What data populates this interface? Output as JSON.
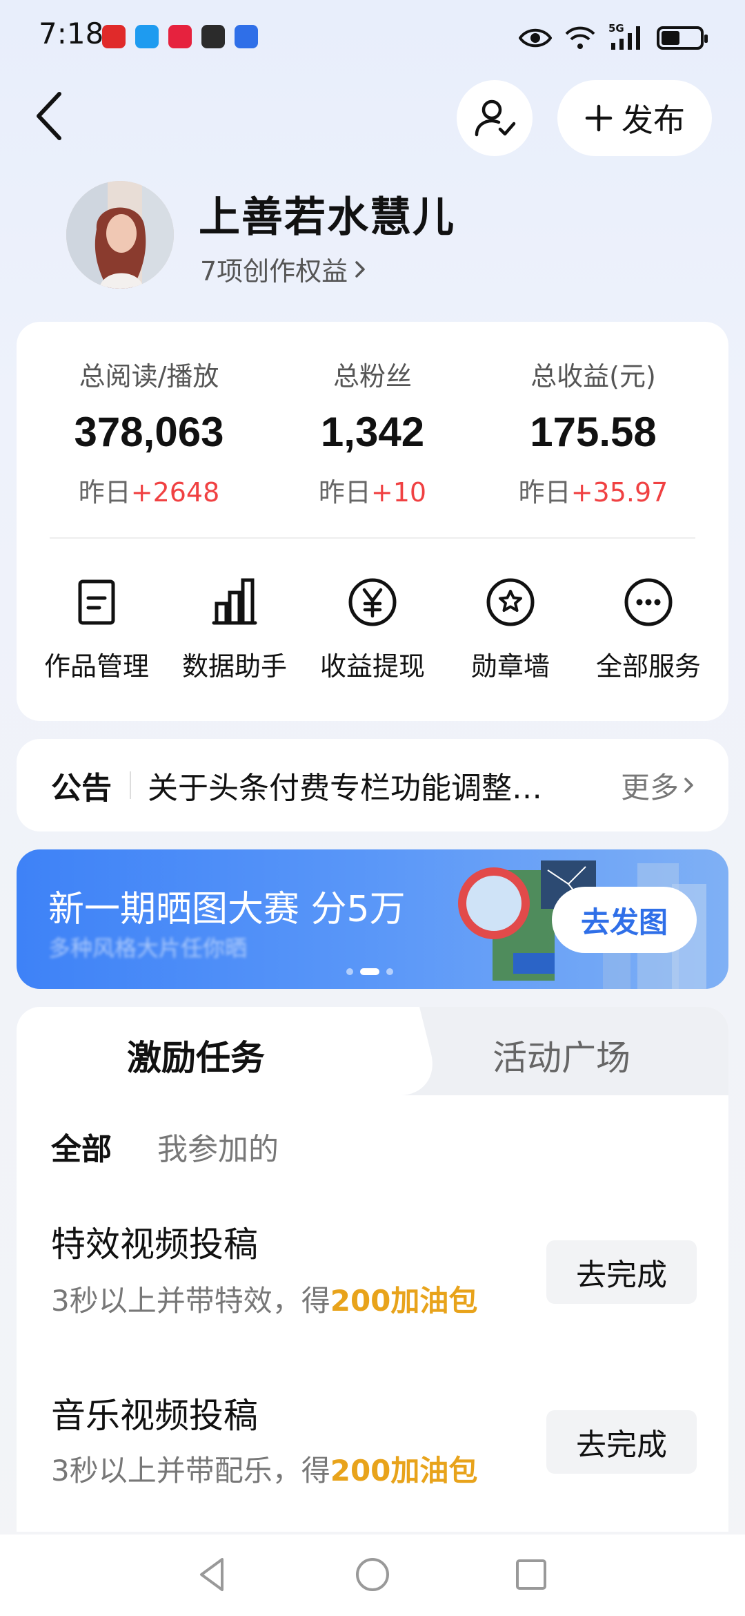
{
  "status_bar": {
    "time": "7:18",
    "network": "5G"
  },
  "header": {
    "back_icon": "chevron-left-icon",
    "follow_icon": "user-check-icon",
    "publish_label": "发布"
  },
  "profile": {
    "name": "上善若水慧儿",
    "benefits": "7项创作权益"
  },
  "stats": [
    {
      "label": "总阅读/播放",
      "value": "378,063",
      "delta_prefix": "昨日",
      "delta": "+2648"
    },
    {
      "label": "总粉丝",
      "value": "1,342",
      "delta_prefix": "昨日",
      "delta": "+10"
    },
    {
      "label": "总收益(元)",
      "value": "175.58",
      "delta_prefix": "昨日",
      "delta": "+35.97"
    }
  ],
  "services": [
    {
      "label": "作品管理",
      "icon": "document-icon"
    },
    {
      "label": "数据助手",
      "icon": "bar-chart-icon"
    },
    {
      "label": "收益提现",
      "icon": "yuan-icon"
    },
    {
      "label": "勋章墙",
      "icon": "medal-icon"
    },
    {
      "label": "全部服务",
      "icon": "more-icon"
    }
  ],
  "notice": {
    "tag": "公告",
    "text": "关于头条付费专栏功能调整…",
    "more": "更多"
  },
  "banner": {
    "title": "新一期晒图大赛 分5万",
    "subtitle": "多种风格大片任你晒",
    "button": "去发图"
  },
  "tasks": {
    "tabs": [
      "激励任务",
      "活动广场"
    ],
    "filters": [
      "全部",
      "我参加的"
    ],
    "items": [
      {
        "title": "特效视频投稿",
        "desc_prefix": "3秒以上并带特效，得",
        "reward": "200加油包",
        "button": "去完成"
      },
      {
        "title": "音乐视频投稿",
        "desc_prefix": "3秒以上并带配乐，得",
        "reward": "200加油包",
        "button": "去完成"
      }
    ]
  },
  "colors": {
    "accent_blue": "#3e82f7",
    "delta_red": "#f04142",
    "reward_orange": "#e8a31b"
  }
}
